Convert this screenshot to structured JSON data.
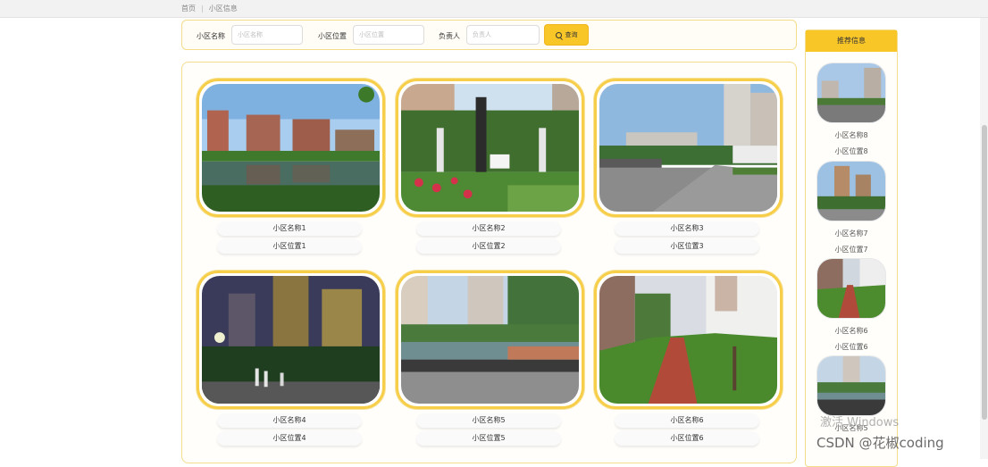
{
  "breadcrumb": {
    "home": "首页",
    "current": "小区信息"
  },
  "search": {
    "name_label": "小区名称",
    "name_placeholder": "小区名称",
    "location_label": "小区位置",
    "location_placeholder": "小区位置",
    "manager_label": "负责人",
    "manager_placeholder": "负责人",
    "query_button": "查询"
  },
  "cards": [
    {
      "name": "小区名称1",
      "location": "小区位置1",
      "scene": "lake-towers"
    },
    {
      "name": "小区名称2",
      "location": "小区位置2",
      "scene": "garden-flowers"
    },
    {
      "name": "小区名称3",
      "location": "小区位置3",
      "scene": "street-gate"
    },
    {
      "name": "小区名称4",
      "location": "小区位置4",
      "scene": "night-towers"
    },
    {
      "name": "小区名称5",
      "location": "小区位置5",
      "scene": "pond-bridge"
    },
    {
      "name": "小区名称6",
      "location": "小区位置6",
      "scene": "red-path"
    }
  ],
  "sidebar": {
    "title": "推荐信息",
    "items": [
      {
        "name": "小区名称8",
        "location": "小区位置8"
      },
      {
        "name": "小区名称7",
        "location": "小区位置7"
      },
      {
        "name": "小区名称6",
        "location": "小区位置6"
      },
      {
        "name": "小区名称5",
        "location": ""
      }
    ]
  },
  "watermark": {
    "line1": "激活 Windows",
    "csdn": "CSDN @花椒coding"
  },
  "colors": {
    "accent": "#f9c628",
    "frame": "#f6ce4a",
    "border": "#f3dc8a"
  }
}
